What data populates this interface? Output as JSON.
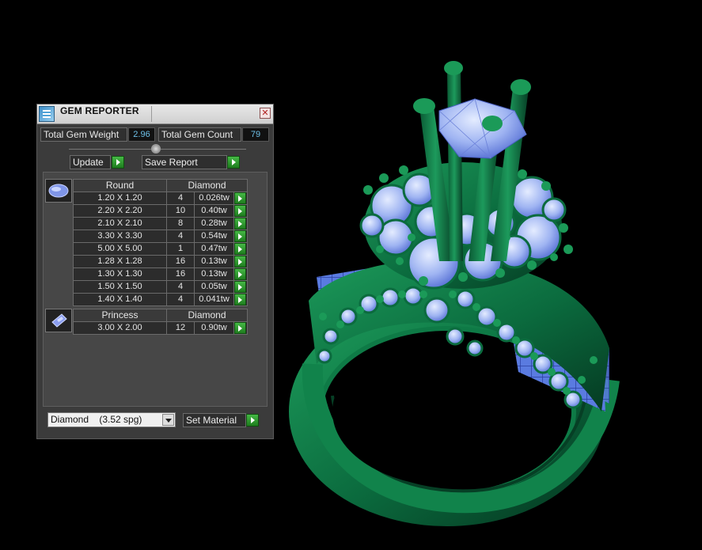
{
  "panel": {
    "title": "GEM REPORTER",
    "close_glyph": "✕",
    "weight_label": "Total Gem Weight",
    "weight_value": "2.96",
    "count_label": "Total Gem Count",
    "count_value": "79",
    "update_label": "Update",
    "save_label": "Save Report",
    "material": "Diamond    (3.52 spg)",
    "set_material_label": "Set Material"
  },
  "groups": [
    {
      "shape": "Round",
      "material": "Diamond",
      "icon": "round-gem-icon",
      "rows": [
        {
          "size": "1.20 X 1.20",
          "qty": "4",
          "weight": "0.026tw"
        },
        {
          "size": "2.20 X 2.20",
          "qty": "10",
          "weight": "0.40tw"
        },
        {
          "size": "2.10 X 2.10",
          "qty": "8",
          "weight": "0.28tw"
        },
        {
          "size": "3.30 X 3.30",
          "qty": "4",
          "weight": "0.54tw"
        },
        {
          "size": "5.00 X 5.00",
          "qty": "1",
          "weight": "0.47tw"
        },
        {
          "size": "1.28 X 1.28",
          "qty": "16",
          "weight": "0.13tw"
        },
        {
          "size": "1.30 X 1.30",
          "qty": "16",
          "weight": "0.13tw"
        },
        {
          "size": "1.50 X 1.50",
          "qty": "4",
          "weight": "0.05tw"
        },
        {
          "size": "1.40 X 1.40",
          "qty": "4",
          "weight": "0.041tw"
        }
      ]
    },
    {
      "shape": "Princess",
      "material": "Diamond",
      "icon": "princess-gem-icon",
      "rows": [
        {
          "size": "3.00 X 2.00",
          "qty": "12",
          "weight": "0.90tw"
        }
      ]
    }
  ],
  "colors": {
    "metal": "#0b6b3e",
    "gem": "#8fa8f0",
    "arrow_button": "#2e9a2e"
  }
}
